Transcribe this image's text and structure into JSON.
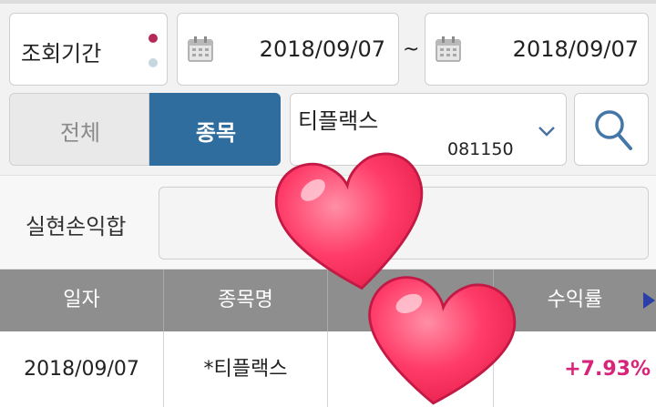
{
  "filters": {
    "period_label": "조회기간",
    "start_date": "2018/09/07",
    "range_separator": "~",
    "end_date": "2018/09/07"
  },
  "scope_tabs": [
    {
      "label": "전체",
      "active": false
    },
    {
      "label": "종목",
      "active": true
    }
  ],
  "stock_select": {
    "name": "티플랙스",
    "code": "081150"
  },
  "summary": {
    "realized_pnl_label": "실현손익합",
    "realized_pnl_value": ""
  },
  "table": {
    "headers": [
      "일자",
      "종목명",
      "",
      "수익률"
    ],
    "rows": [
      {
        "date": "2018/09/07",
        "name": "*티플랙스",
        "amount": "",
        "return_rate": "+7.93%"
      }
    ]
  },
  "colors": {
    "active_tab_bg": "#2e6d9d",
    "positive": "#d8247a",
    "header_bg": "#8e8e8e",
    "toggle_dot_on": "#b62a58",
    "toggle_dot_off": "#c8d6e0",
    "icon_blue": "#4477a8",
    "heart": "#ff3b68"
  },
  "icons": [
    "calendar-icon",
    "chevron-down-icon",
    "search-icon",
    "arrow-right-icon",
    "heart-sticker"
  ]
}
